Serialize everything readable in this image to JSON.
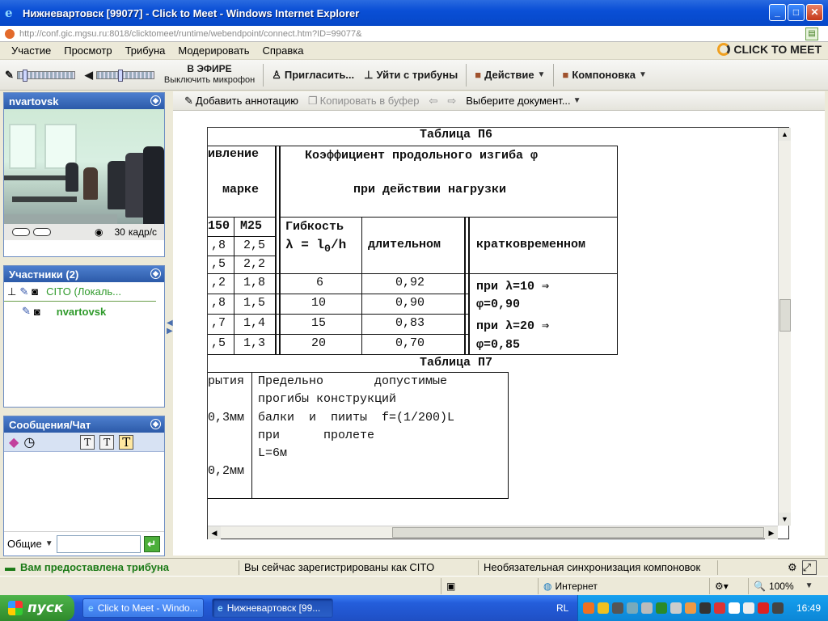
{
  "window": {
    "title": "Нижневартовск [99077] - Click to Meet - Windows Internet Explorer",
    "url": "http://conf.gic.mgsu.ru:8018/clicktomeet/runtime/webendpoint/connect.htm?ID=99077&"
  },
  "menu": [
    "Участие",
    "Просмотр",
    "Трибуна",
    "Модерировать",
    "Справка"
  ],
  "logo": "CLICK TO MEET",
  "toolbar": {
    "on_air": "В ЭФИРЕ",
    "mute": "Выключить микрофон",
    "invite": "Пригласить...",
    "leave": "Уйти с трибуны",
    "action": "Действие",
    "layout": "Компоновка"
  },
  "video": {
    "title": "nvartovsk",
    "fps": "30",
    "fps_unit": "кадр/с"
  },
  "participants": {
    "title": "Участники (2)",
    "items": [
      "CITO (Локаль...",
      "nvartovsk"
    ]
  },
  "chat": {
    "title": "Сообщения/Чат",
    "scope": "Общие"
  },
  "annot": {
    "add": "Добавить аннотацию",
    "copy": "Копировать в буфер",
    "select_doc": "Выберите документ..."
  },
  "doc": {
    "t6_title": "Таблица П6",
    "c1_head1": "ивление",
    "c1_head2": "марке",
    "c1_col_a": "150",
    "c1_col_b": "М25",
    "c1_rows": [
      [
        ",8",
        "2,5"
      ],
      [
        ",5",
        "2,2"
      ],
      [
        ",2",
        "1,8"
      ],
      [
        ",8",
        "1,5"
      ],
      [
        ",7",
        "1,4"
      ],
      [
        ",5",
        "1,3"
      ]
    ],
    "coef_head1": "Коэффициент продольного изгиба φ",
    "coef_head2": "при действии нагрузки",
    "flex_head1": "Гибкость",
    "flex_head2": "λ = l",
    "flex_sub": "0",
    "flex_head3": "/h",
    "long_head": "длительном",
    "short_head": "кратковременном",
    "flex_vals": [
      "6",
      "10",
      "15",
      "20"
    ],
    "long_vals": [
      "0,92",
      "0,90",
      "0,83",
      "0,70"
    ],
    "short_lines": [
      "при λ=10 ⇒",
      "φ=0,90",
      "при λ=20 ⇒",
      "φ=0,85"
    ],
    "t7_title": "Таблица П7",
    "t7_left": [
      "рытия",
      "0,3мм",
      "0,2мм"
    ],
    "t7_lines": [
      "Предельно       допустимые",
      "прогибы конструкций",
      "балки  и  пииты  f=(1/200)L",
      "при      пролете",
      "L=6м"
    ]
  },
  "status": {
    "tribune": "Вам предоставлена трибуна",
    "registered": "Вы сейчас зарегистрированы как CITO",
    "sync": "Необязательная синхронизация компоновок",
    "zone": "Интернет",
    "zoom": "100%"
  },
  "taskbar": {
    "start": "пуск",
    "tasks": [
      "Click to Meet - Windo...",
      "Нижневартовск [99..."
    ],
    "lang": "RL",
    "clock": "16:49"
  },
  "colors": {
    "accent": "#245edb",
    "panel_head": "#2c5aa8",
    "green_status": "#2f8a2b"
  }
}
